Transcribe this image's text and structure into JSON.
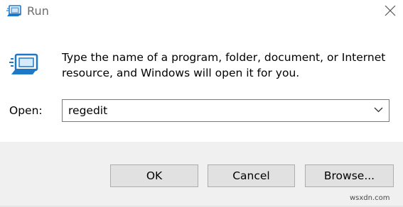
{
  "window": {
    "title": "Run",
    "title_icon": "run-icon",
    "close_icon": "close-icon"
  },
  "dialog": {
    "icon": "run-app-icon",
    "description_line1": "Type the name of a program, folder, document, or Internet",
    "description_line2": "resource, and Windows will open it for you.",
    "open_label": "Open:",
    "open_value": "regedit",
    "dropdown_icon": "chevron-down-icon"
  },
  "buttons": {
    "ok": "OK",
    "cancel": "Cancel",
    "browse": "Browse..."
  },
  "watermark": "wsxdn.com",
  "colors": {
    "icon_blue": "#1e78c8",
    "footer_bg": "#f0f0f0",
    "button_bg": "#e1e1e1",
    "button_border": "#adadad",
    "title_text": "#6d6d6d"
  }
}
